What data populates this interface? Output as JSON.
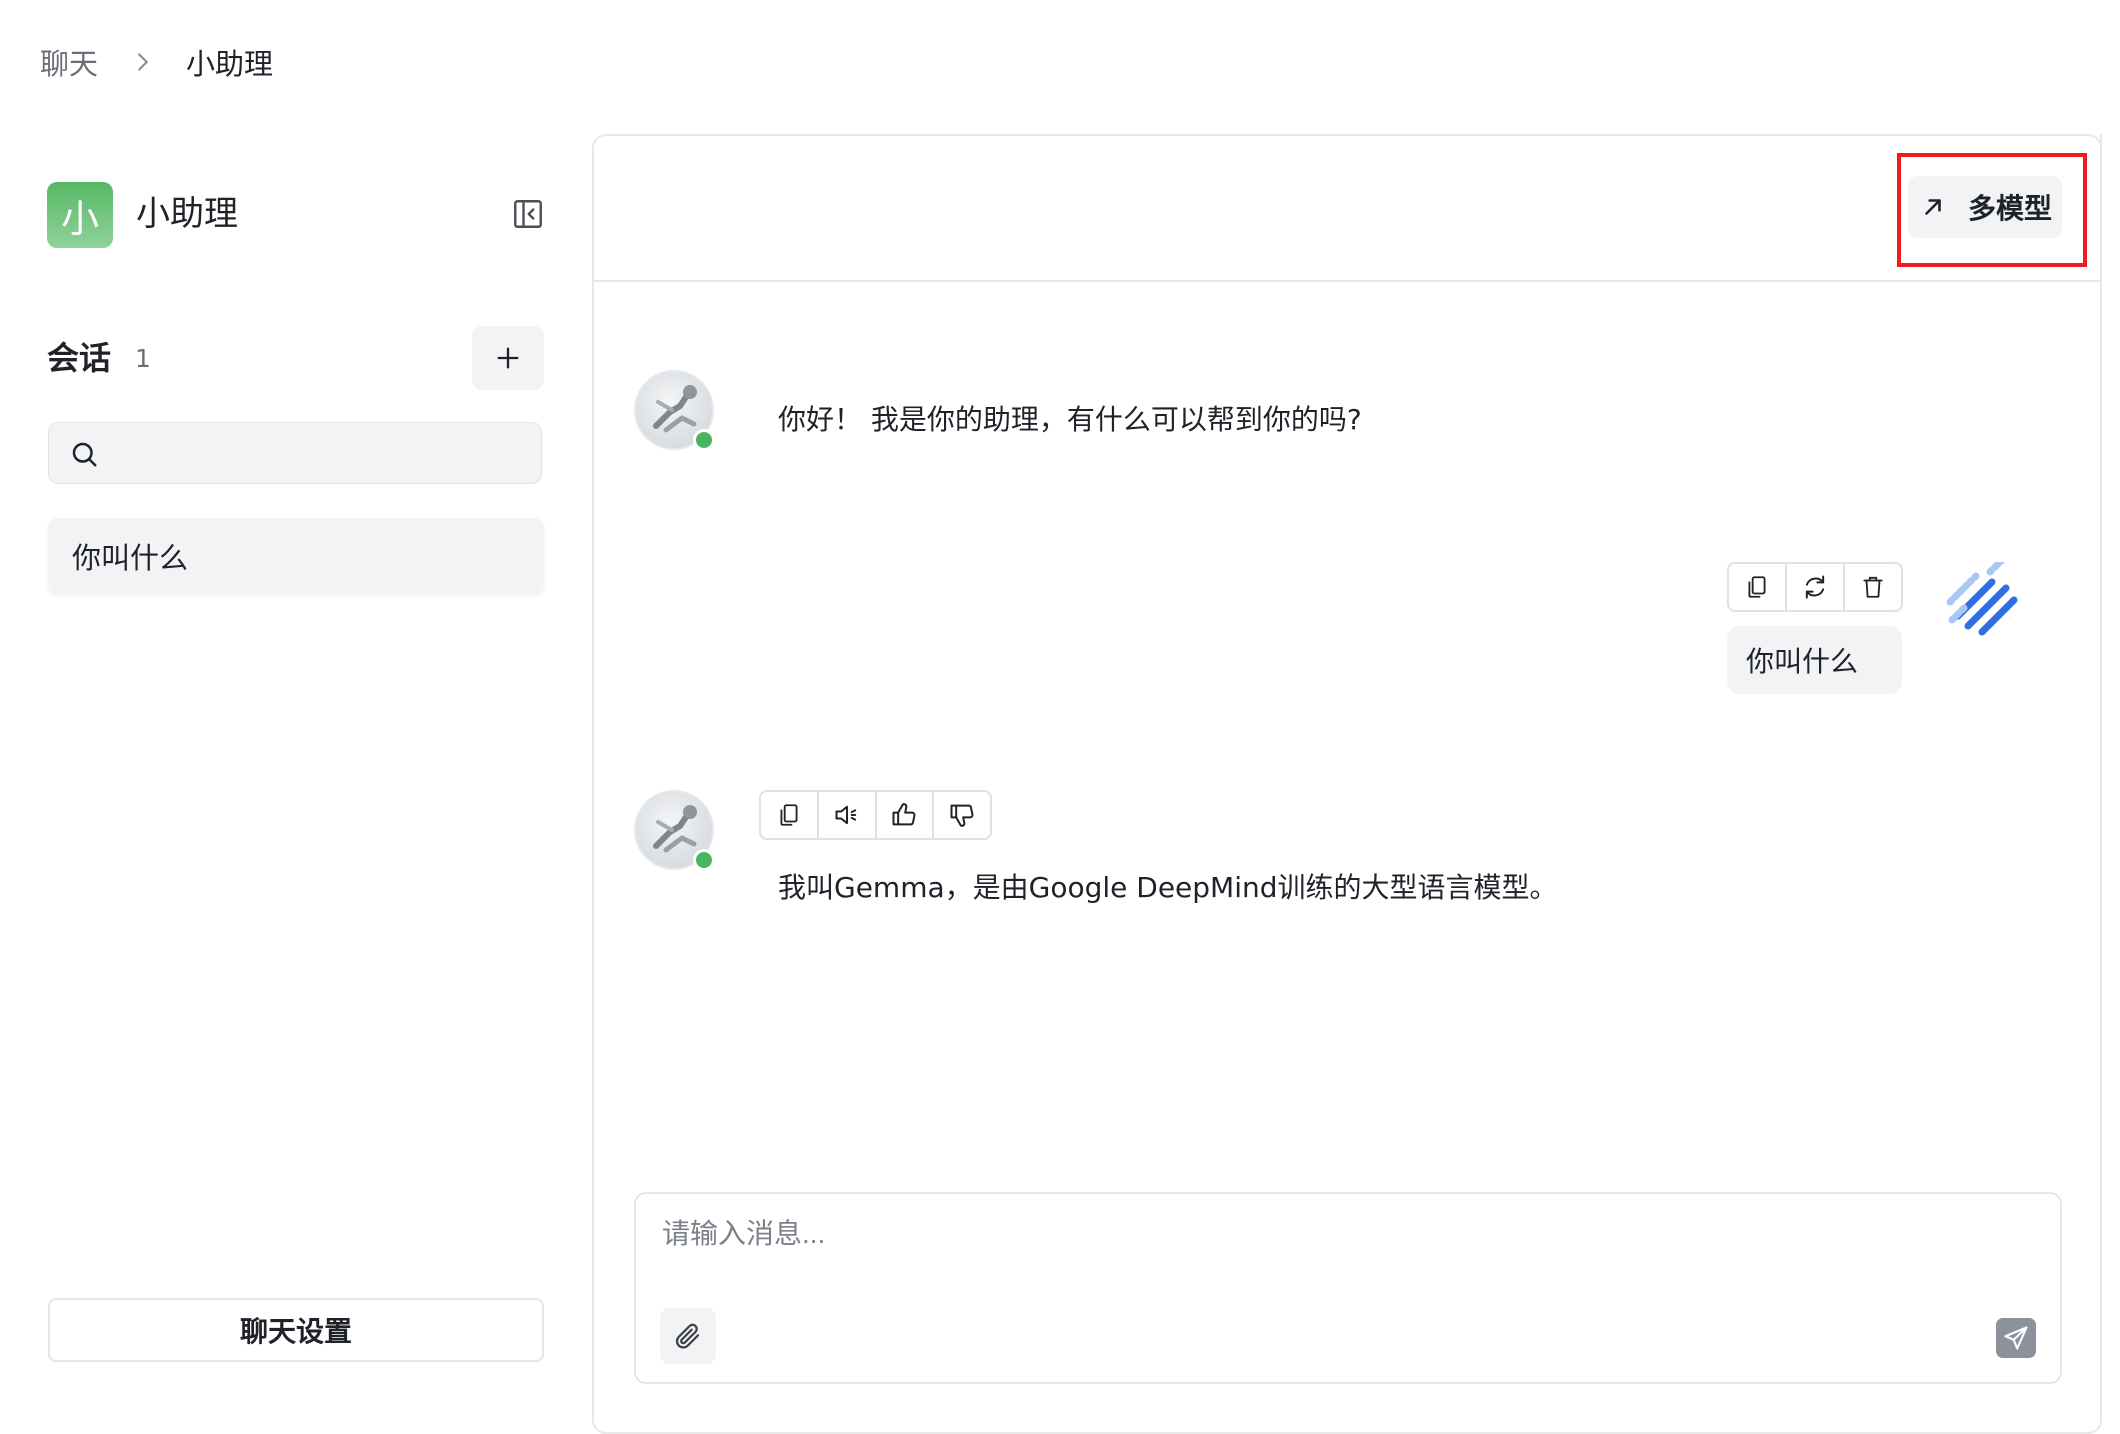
{
  "breadcrumb": {
    "root": "聊天",
    "current": "小助理"
  },
  "sidebar": {
    "avatar_char": "小",
    "app_name": "小助理",
    "conversations_title": "会话",
    "conversations_count": "1",
    "search_placeholder": "",
    "items": [
      {
        "label": "你叫什么"
      }
    ],
    "settings_label": "聊天设置"
  },
  "header": {
    "multi_model_label": "多模型"
  },
  "messages": [
    {
      "role": "assistant",
      "text": "你好！ 我是你的助理，有什么可以帮到你的吗?"
    },
    {
      "role": "user",
      "text": "你叫什么"
    },
    {
      "role": "assistant",
      "text": "我叫Gemma，是由Google DeepMind训练的大型语言模型。"
    }
  ],
  "input": {
    "placeholder": "请输入消息..."
  },
  "colors": {
    "accent_green": "#57b866",
    "online_green": "#49b462",
    "highlight_red": "#ee1c1c",
    "user_avatar_blue": "#2f6fe4"
  }
}
